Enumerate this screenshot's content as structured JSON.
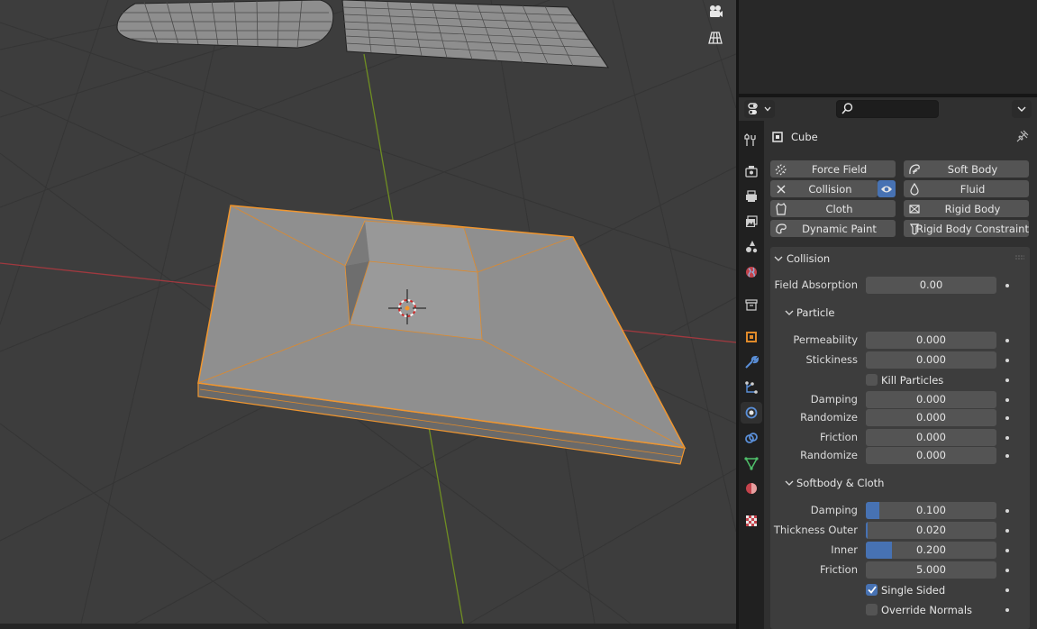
{
  "object": {
    "name": "Cube"
  },
  "physics_buttons": [
    {
      "label": "Force Field",
      "icon": "force-field-icon"
    },
    {
      "label": "Soft Body",
      "icon": "soft-body-icon"
    },
    {
      "label": "Collision",
      "icon": "close-icon",
      "enabled": true
    },
    {
      "label": "Fluid",
      "icon": "fluid-icon"
    },
    {
      "label": "Cloth",
      "icon": "cloth-icon"
    },
    {
      "label": "Rigid Body",
      "icon": "rigid-body-icon"
    },
    {
      "label": "Dynamic Paint",
      "icon": "dynamic-paint-icon"
    },
    {
      "label": "Rigid Body Constraint",
      "icon": "rigid-body-constraint-icon"
    }
  ],
  "collision": {
    "title": "Collision",
    "field_absorption": {
      "label": "Field Absorption",
      "value": "0.00"
    },
    "particle": {
      "title": "Particle",
      "permeability": {
        "label": "Permeability",
        "value": "0.000"
      },
      "stickiness": {
        "label": "Stickiness",
        "value": "0.000"
      },
      "kill_particles": {
        "label": "Kill Particles",
        "checked": false
      },
      "damping": {
        "label": "Damping",
        "value": "0.000"
      },
      "damping_randomize": {
        "label": "Randomize",
        "value": "0.000"
      },
      "friction": {
        "label": "Friction",
        "value": "0.000"
      },
      "friction_randomize": {
        "label": "Randomize",
        "value": "0.000"
      }
    },
    "softbody_cloth": {
      "title": "Softbody & Cloth",
      "damping": {
        "label": "Damping",
        "value": "0.100",
        "fraction": 0.1
      },
      "thickness_outer": {
        "label": "Thickness Outer",
        "value": "0.020",
        "fraction": 0.02
      },
      "inner": {
        "label": "Inner",
        "value": "0.200",
        "fraction": 0.2
      },
      "friction": {
        "label": "Friction",
        "value": "5.000",
        "fraction": 0.0
      },
      "single_sided": {
        "label": "Single Sided",
        "checked": true
      },
      "override_normals": {
        "label": "Override Normals",
        "checked": false
      }
    }
  },
  "colors": {
    "accent": "#4772b3",
    "selection_outline": "#f0962f",
    "x_axis": "#a0393f",
    "y_axis": "#6f8e22"
  }
}
